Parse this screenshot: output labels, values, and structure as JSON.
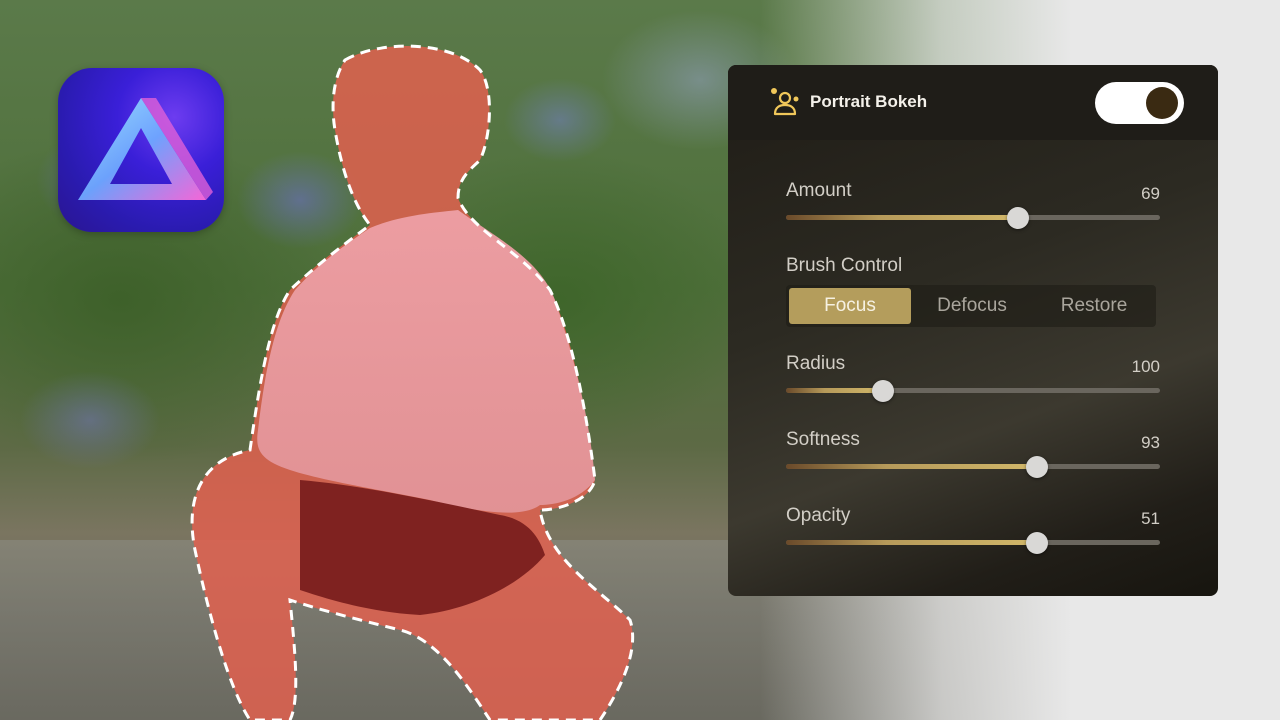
{
  "app": {
    "icon": "luminar-triangle-icon",
    "icon_colors": {
      "bg": "#2a1bb0",
      "accent": "#6d3cf0"
    }
  },
  "panel": {
    "title": "Portrait Bokeh",
    "header_icon": "portrait-people-icon",
    "toggle_on": true,
    "accent_color": "#b49d5c",
    "sliders": [
      {
        "id": "amount",
        "label": "Amount",
        "value": "69",
        "fraction": 0.62
      },
      {
        "id": "radius",
        "label": "Radius",
        "value": "100",
        "fraction": 0.26
      },
      {
        "id": "softness",
        "label": "Softness",
        "value": "93",
        "fraction": 0.67
      },
      {
        "id": "opacity",
        "label": "Opacity",
        "value": "51",
        "fraction": 0.67
      }
    ],
    "brush_control": {
      "label": "Brush Control",
      "options": [
        "Focus",
        "Defocus",
        "Restore"
      ],
      "selected": "Focus"
    }
  },
  "canvas": {
    "selection_overlay_color": "#e0504a",
    "selection_outline": "dashed-white"
  }
}
